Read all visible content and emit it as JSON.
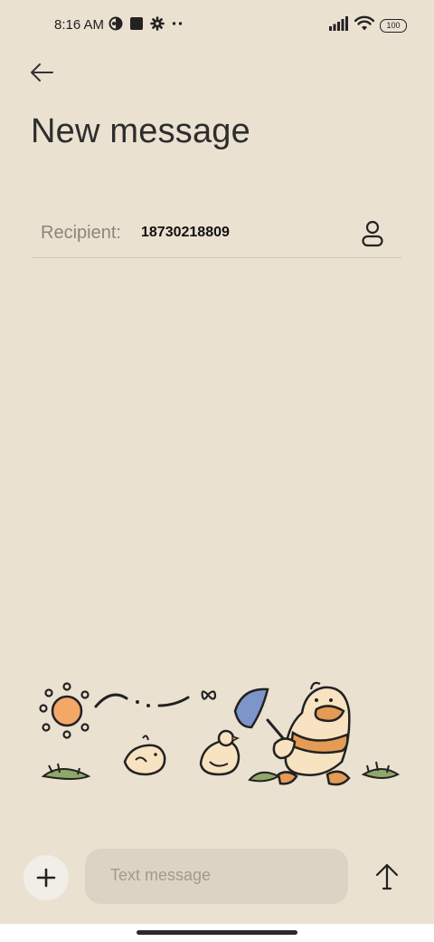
{
  "status_bar": {
    "time": "8:16 AM",
    "left_icons": [
      "data-saver-icon",
      "stop-square-icon",
      "gear-icon",
      "more-dots-icon"
    ],
    "right_icons": [
      "cellular-signal-icon",
      "wifi-icon",
      "battery-icon"
    ],
    "battery_level": "100"
  },
  "header": {
    "back_icon": "arrow-left-icon",
    "title": "New message"
  },
  "recipient": {
    "label": "Recipient:",
    "value": "18730218809",
    "contact_icon": "person-icon"
  },
  "compose": {
    "add_icon": "plus-icon",
    "placeholder": "Text message",
    "send_icon": "arrow-up-icon"
  },
  "colors": {
    "background": "#ebe1d1",
    "input_background": "#ddd3c5",
    "add_button_background": "#f1ede7",
    "sun": "#f3a868",
    "net": "#7d95c8",
    "duck": "#f7e3c2",
    "scarf": "#e39b55",
    "grass": "#8fa86a"
  }
}
